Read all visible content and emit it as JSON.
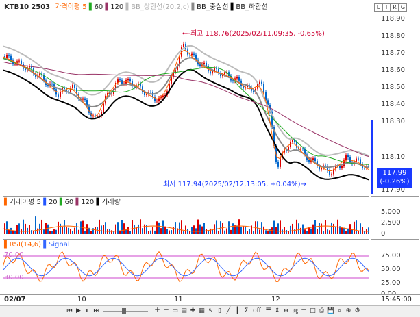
{
  "legend_main": {
    "symbol": "KTB10",
    "code": "2503",
    "ma_label": "가격이평 5",
    "ma60": "60",
    "ma120": "120",
    "bb_upper": "BB_상한선(20,2,c)",
    "bb_mid": "BB_중심선",
    "bb_lower": "BB_하한선"
  },
  "legend_vol": {
    "label": "거래이평 5",
    "p20": "20",
    "p60": "60",
    "p120": "120",
    "vol": "거래량"
  },
  "legend_rsi": {
    "label": "RSI(14,6)",
    "signal": "Signal",
    "lvl70": "70.00",
    "lvl30": "30.00"
  },
  "annotations": {
    "high": "←-최고 118.76(2025/02/11,09:35, -0.65%)",
    "low": "최저 117.94(2025/02/12,13:05, +0.04%)→"
  },
  "price_axis": [
    "118.90",
    "118.80",
    "118.70",
    "118.60",
    "118.50",
    "118.40",
    "118.30",
    "118.10",
    "117.90"
  ],
  "current_price": "117.99",
  "current_change": "(-0.26%)",
  "vol_axis": [
    "5,000",
    "2,500",
    "0"
  ],
  "rsi_axis": [
    "75.00",
    "50.00",
    "25.00",
    "0.00"
  ],
  "x_labels": {
    "start": "02/07",
    "d10": "10",
    "d11": "11",
    "d12": "12",
    "time": "15:45:00"
  },
  "corner_buttons": [
    "L",
    "I",
    "R",
    "G"
  ],
  "colors": {
    "ma5": "#ff6600",
    "ma20": "#2255ff",
    "ma60": "#22aa22",
    "ma120": "#993366",
    "bb_upper": "#bbbbbb",
    "bb_mid": "#888888",
    "bb_lower": "#000000",
    "rsi": "#ff6600",
    "signal": "#3366ff",
    "accent": "#cc0033",
    "current_bg": "#1a3aff"
  },
  "toolbar_icons": [
    "scroll-start-icon",
    "play-icon",
    "pause-icon",
    "scroll-end-icon",
    "zoom-slider",
    "zoom-in-icon",
    "zoom-out-icon",
    "fit-icon",
    "chart-icon",
    "cross-icon",
    "grid-icon",
    "cursor-icon",
    "bar-icon",
    "line-icon",
    "candle-icon",
    "sum-icon",
    "off-icon",
    "list-icon",
    "scale-icon",
    "ruler-icon",
    "log-icon",
    "min-icon",
    "max-icon",
    "print-icon",
    "save-icon",
    "search-icon",
    "zoom-icon",
    "settings-icon"
  ]
}
